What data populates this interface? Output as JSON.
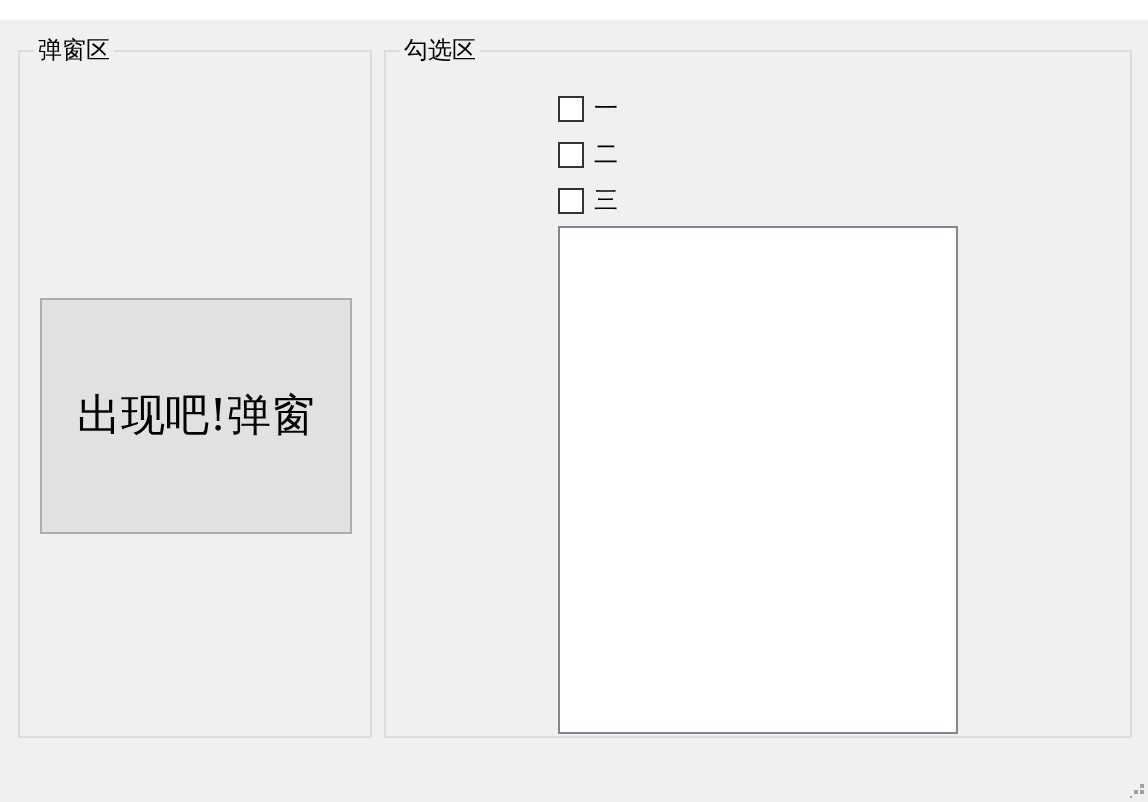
{
  "popup_group": {
    "title": "弹窗区",
    "button": "出现吧!弹窗"
  },
  "check_group": {
    "title": "勾选区",
    "checkboxes": [
      {
        "label": "一",
        "checked": false
      },
      {
        "label": "二",
        "checked": false
      },
      {
        "label": "三",
        "checked": false
      }
    ]
  }
}
